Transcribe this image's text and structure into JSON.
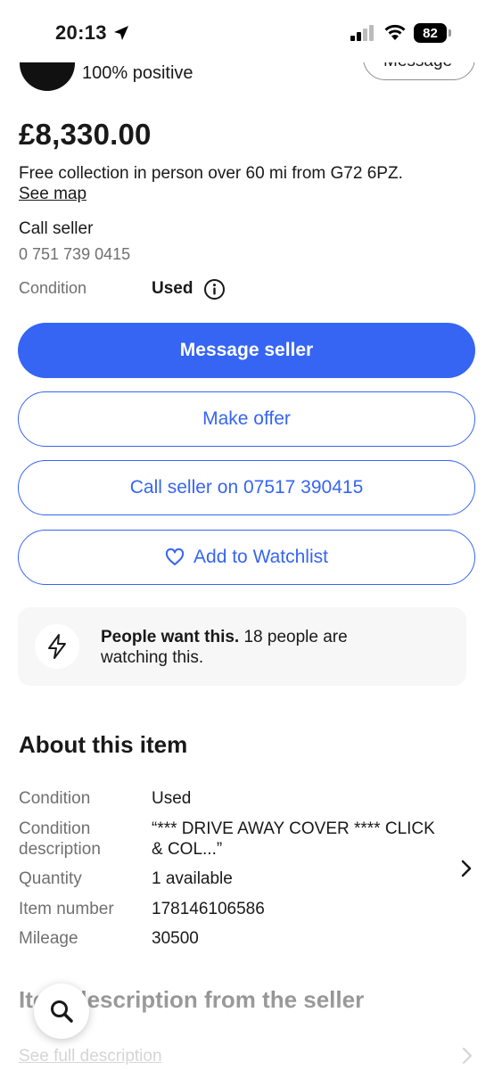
{
  "status_bar": {
    "time": "20:13",
    "battery": "82"
  },
  "seller": {
    "feedback": "100% positive",
    "message_button": "Message"
  },
  "listing": {
    "price": "£8,330.00",
    "delivery": "Free collection in person over 60 mi from G72 6PZ.",
    "see_map": "See map",
    "call_label": "Call seller",
    "phone": "0 751 739 0415",
    "condition_label": "Condition",
    "condition_value": "Used"
  },
  "actions": {
    "message_seller": "Message seller",
    "make_offer": "Make offer",
    "call_seller": "Call seller on 07517 390415",
    "add_watchlist": "Add to Watchlist"
  },
  "signal": {
    "bold": "People want this.",
    "text": " 18 people are watching this."
  },
  "about": {
    "title": "About this item",
    "specs": [
      {
        "label": "Condition",
        "value": "Used"
      },
      {
        "label": "Condition description",
        "value": "“*** DRIVE AWAY COVER **** CLICK & COL...”"
      },
      {
        "label": "Quantity",
        "value": "1 available"
      },
      {
        "label": "Item number",
        "value": "178146106586"
      },
      {
        "label": "Mileage",
        "value": "30500"
      }
    ]
  },
  "description": {
    "title": "Item description from the seller",
    "see_full": "See full description"
  },
  "colors": {
    "accent": "#3665f3",
    "text": "#191919",
    "muted": "#707070"
  },
  "icons": [
    "location-arrow-icon",
    "signal-icon",
    "wifi-icon",
    "battery-icon",
    "info-icon",
    "heart-icon",
    "lightning-icon",
    "chevron-right-icon",
    "search-icon"
  ]
}
